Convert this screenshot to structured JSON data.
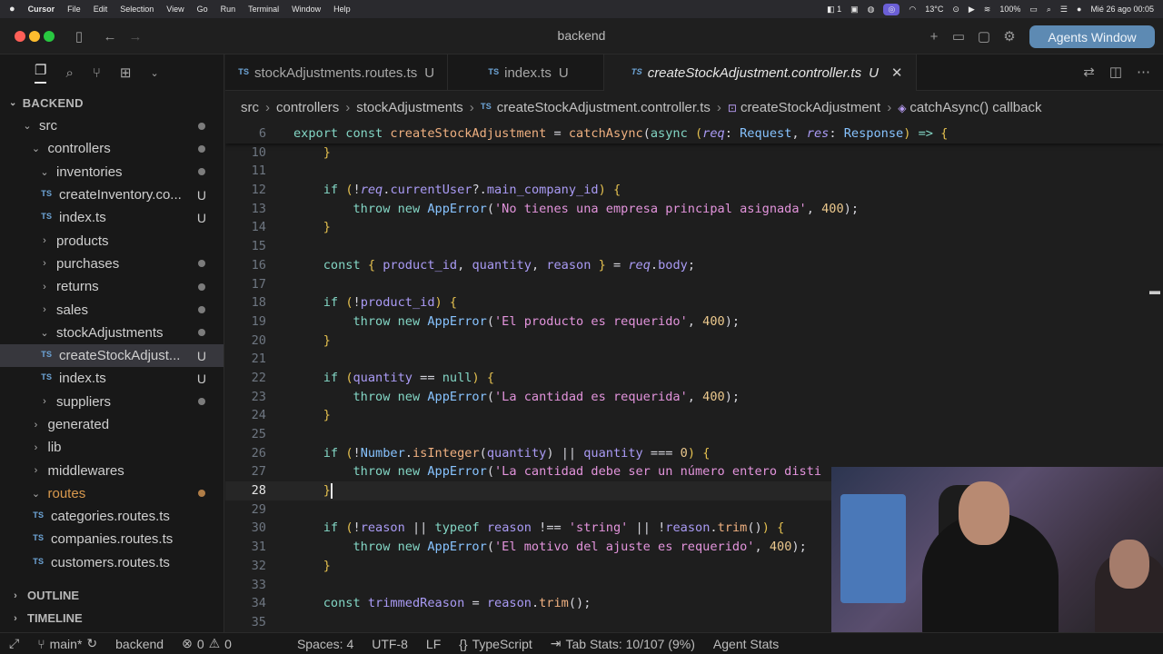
{
  "menubar": {
    "app": "Cursor",
    "items": [
      "File",
      "Edit",
      "Selection",
      "View",
      "Go",
      "Run",
      "Terminal",
      "Window",
      "Help"
    ],
    "status": {
      "badge": "1",
      "temp": "13°C",
      "battery": "100%",
      "datetime": "Mié 26 ago  00:05"
    }
  },
  "window": {
    "title": "backend",
    "agents_button": "Agents Window"
  },
  "sidebar": {
    "tabs": [
      "files-icon",
      "search-icon",
      "source-control-icon",
      "extensions-icon",
      "chevron-down-icon"
    ],
    "header": "BACKEND",
    "tree": [
      {
        "label": "src",
        "level": 0,
        "type": "folder-open",
        "dot": true
      },
      {
        "label": "controllers",
        "level": 1,
        "type": "folder-open",
        "dot": true
      },
      {
        "label": "inventories",
        "level": 2,
        "type": "folder-open",
        "dot": true
      },
      {
        "label": "createInventory.co...",
        "level": 3,
        "type": "file",
        "badge": "U"
      },
      {
        "label": "index.ts",
        "level": 3,
        "type": "file",
        "badge": "U"
      },
      {
        "label": "products",
        "level": 2,
        "type": "folder",
        "dot": false
      },
      {
        "label": "purchases",
        "level": 2,
        "type": "folder",
        "dot": true
      },
      {
        "label": "returns",
        "level": 2,
        "type": "folder",
        "dot": true
      },
      {
        "label": "sales",
        "level": 2,
        "type": "folder",
        "dot": true
      },
      {
        "label": "stockAdjustments",
        "level": 2,
        "type": "folder-open",
        "dot": true
      },
      {
        "label": "createStockAdjust...",
        "level": 3,
        "type": "file",
        "badge": "U",
        "selected": true
      },
      {
        "label": "index.ts",
        "level": 3,
        "type": "file",
        "badge": "U"
      },
      {
        "label": "suppliers",
        "level": 2,
        "type": "folder",
        "dot": true
      },
      {
        "label": "generated",
        "level": 1,
        "type": "folder",
        "dot": false
      },
      {
        "label": "lib",
        "level": 1,
        "type": "folder",
        "dot": false
      },
      {
        "label": "middlewares",
        "level": 1,
        "type": "folder",
        "dot": false
      },
      {
        "label": "routes",
        "level": 1,
        "type": "folder-open",
        "dot": true,
        "orange": true
      },
      {
        "label": "categories.routes.ts",
        "level": 2,
        "type": "file"
      },
      {
        "label": "companies.routes.ts",
        "level": 2,
        "type": "file"
      },
      {
        "label": "customers.routes.ts",
        "level": 2,
        "type": "file"
      }
    ],
    "outline": "OUTLINE",
    "timeline": "TIMELINE"
  },
  "tabs": [
    {
      "label": "stockAdjustments.routes.ts",
      "badge": "U",
      "active": false
    },
    {
      "label": "index.ts",
      "badge": "U",
      "active": false
    },
    {
      "label": "createStockAdjustment.controller.ts",
      "badge": "U",
      "active": true
    }
  ],
  "breadcrumb": [
    "src",
    "controllers",
    "stockAdjustments",
    "createStockAdjustment.controller.ts",
    "createStockAdjustment",
    "catchAsync() callback"
  ],
  "editor": {
    "sticky": {
      "ln": "6",
      "tokens": [
        [
          "k",
          "export "
        ],
        [
          "k",
          "const "
        ],
        [
          "f",
          "createStockAdjustment"
        ],
        [
          "v",
          " = "
        ],
        [
          "f",
          "catchAsync"
        ],
        [
          "v",
          "("
        ],
        [
          "k",
          "async "
        ],
        [
          "b",
          "("
        ],
        [
          "p i",
          "req"
        ],
        [
          "v",
          ": "
        ],
        [
          "t",
          "Request"
        ],
        [
          "v",
          ", "
        ],
        [
          "p i",
          "res"
        ],
        [
          "v",
          ": "
        ],
        [
          "t",
          "Response"
        ],
        [
          "b",
          ")"
        ],
        [
          "k",
          " => "
        ],
        [
          "b",
          "{"
        ]
      ]
    },
    "current_line": "28",
    "lines": [
      {
        "ln": "10",
        "tokens": [
          [
            "v",
            "    "
          ],
          [
            "b",
            "}"
          ]
        ]
      },
      {
        "ln": "11",
        "tokens": []
      },
      {
        "ln": "12",
        "tokens": [
          [
            "v",
            "    "
          ],
          [
            "k",
            "if "
          ],
          [
            "b",
            "("
          ],
          [
            "v",
            "!"
          ],
          [
            "p i",
            "req"
          ],
          [
            "v",
            "."
          ],
          [
            "p",
            "currentUser"
          ],
          [
            "v",
            "?."
          ],
          [
            "p",
            "main_company_id"
          ],
          [
            "b",
            ")"
          ],
          [
            "v",
            " "
          ],
          [
            "b",
            "{"
          ]
        ]
      },
      {
        "ln": "13",
        "tokens": [
          [
            "v",
            "        "
          ],
          [
            "k",
            "throw new "
          ],
          [
            "t",
            "AppError"
          ],
          [
            "v",
            "("
          ],
          [
            "s",
            "'No tienes una empresa principal asignada'"
          ],
          [
            "v",
            ", "
          ],
          [
            "n",
            "400"
          ],
          [
            "v",
            ");"
          ]
        ]
      },
      {
        "ln": "14",
        "tokens": [
          [
            "v",
            "    "
          ],
          [
            "b",
            "}"
          ]
        ]
      },
      {
        "ln": "15",
        "tokens": []
      },
      {
        "ln": "16",
        "tokens": [
          [
            "v",
            "    "
          ],
          [
            "k",
            "const "
          ],
          [
            "b",
            "{"
          ],
          [
            "v",
            " "
          ],
          [
            "p",
            "product_id"
          ],
          [
            "v",
            ", "
          ],
          [
            "p",
            "quantity"
          ],
          [
            "v",
            ", "
          ],
          [
            "p",
            "reason"
          ],
          [
            "v",
            " "
          ],
          [
            "b",
            "}"
          ],
          [
            "v",
            " = "
          ],
          [
            "p i",
            "req"
          ],
          [
            "v",
            "."
          ],
          [
            "p",
            "body"
          ],
          [
            "v",
            ";"
          ]
        ]
      },
      {
        "ln": "17",
        "tokens": []
      },
      {
        "ln": "18",
        "tokens": [
          [
            "v",
            "    "
          ],
          [
            "k",
            "if "
          ],
          [
            "b",
            "("
          ],
          [
            "v",
            "!"
          ],
          [
            "p",
            "product_id"
          ],
          [
            "b",
            ")"
          ],
          [
            "v",
            " "
          ],
          [
            "b",
            "{"
          ]
        ]
      },
      {
        "ln": "19",
        "tokens": [
          [
            "v",
            "        "
          ],
          [
            "k",
            "throw new "
          ],
          [
            "t",
            "AppError"
          ],
          [
            "v",
            "("
          ],
          [
            "s",
            "'El producto es requerido'"
          ],
          [
            "v",
            ", "
          ],
          [
            "n",
            "400"
          ],
          [
            "v",
            ");"
          ]
        ]
      },
      {
        "ln": "20",
        "tokens": [
          [
            "v",
            "    "
          ],
          [
            "b",
            "}"
          ]
        ]
      },
      {
        "ln": "21",
        "tokens": []
      },
      {
        "ln": "22",
        "tokens": [
          [
            "v",
            "    "
          ],
          [
            "k",
            "if "
          ],
          [
            "b",
            "("
          ],
          [
            "p",
            "quantity"
          ],
          [
            "v",
            " == "
          ],
          [
            "k",
            "null"
          ],
          [
            "b",
            ")"
          ],
          [
            "v",
            " "
          ],
          [
            "b",
            "{"
          ]
        ]
      },
      {
        "ln": "23",
        "tokens": [
          [
            "v",
            "        "
          ],
          [
            "k",
            "throw new "
          ],
          [
            "t",
            "AppError"
          ],
          [
            "v",
            "("
          ],
          [
            "s",
            "'La cantidad es requerida'"
          ],
          [
            "v",
            ", "
          ],
          [
            "n",
            "400"
          ],
          [
            "v",
            ");"
          ]
        ]
      },
      {
        "ln": "24",
        "tokens": [
          [
            "v",
            "    "
          ],
          [
            "b",
            "}"
          ]
        ]
      },
      {
        "ln": "25",
        "tokens": []
      },
      {
        "ln": "26",
        "tokens": [
          [
            "v",
            "    "
          ],
          [
            "k",
            "if "
          ],
          [
            "b",
            "("
          ],
          [
            "v",
            "!"
          ],
          [
            "t",
            "Number"
          ],
          [
            "v",
            "."
          ],
          [
            "f",
            "isInteger"
          ],
          [
            "v",
            "("
          ],
          [
            "p",
            "quantity"
          ],
          [
            "v",
            ") || "
          ],
          [
            "p",
            "quantity"
          ],
          [
            "v",
            " === "
          ],
          [
            "n",
            "0"
          ],
          [
            "b",
            ")"
          ],
          [
            "v",
            " "
          ],
          [
            "b",
            "{"
          ]
        ]
      },
      {
        "ln": "27",
        "tokens": [
          [
            "v",
            "        "
          ],
          [
            "k",
            "throw new "
          ],
          [
            "t",
            "AppError"
          ],
          [
            "v",
            "("
          ],
          [
            "s",
            "'La cantidad debe ser un número entero disti"
          ]
        ]
      },
      {
        "ln": "28",
        "tokens": [
          [
            "v",
            "    "
          ],
          [
            "b",
            "}"
          ]
        ],
        "cursor": true
      },
      {
        "ln": "29",
        "tokens": []
      },
      {
        "ln": "30",
        "tokens": [
          [
            "v",
            "    "
          ],
          [
            "k",
            "if "
          ],
          [
            "b",
            "("
          ],
          [
            "v",
            "!"
          ],
          [
            "p",
            "reason"
          ],
          [
            "v",
            " || "
          ],
          [
            "k",
            "typeof "
          ],
          [
            "p",
            "reason"
          ],
          [
            "v",
            " !== "
          ],
          [
            "s",
            "'string'"
          ],
          [
            "v",
            " || !"
          ],
          [
            "p",
            "reason"
          ],
          [
            "v",
            "."
          ],
          [
            "f",
            "trim"
          ],
          [
            "v",
            "()"
          ],
          [
            "b",
            ")"
          ],
          [
            "v",
            " "
          ],
          [
            "b",
            "{"
          ]
        ]
      },
      {
        "ln": "31",
        "tokens": [
          [
            "v",
            "        "
          ],
          [
            "k",
            "throw new "
          ],
          [
            "t",
            "AppError"
          ],
          [
            "v",
            "("
          ],
          [
            "s",
            "'El motivo del ajuste es requerido'"
          ],
          [
            "v",
            ", "
          ],
          [
            "n",
            "400"
          ],
          [
            "v",
            ");"
          ]
        ]
      },
      {
        "ln": "32",
        "tokens": [
          [
            "v",
            "    "
          ],
          [
            "b",
            "}"
          ]
        ]
      },
      {
        "ln": "33",
        "tokens": []
      },
      {
        "ln": "34",
        "tokens": [
          [
            "v",
            "    "
          ],
          [
            "k",
            "const "
          ],
          [
            "p",
            "trimmedReason"
          ],
          [
            "v",
            " = "
          ],
          [
            "p",
            "reason"
          ],
          [
            "v",
            "."
          ],
          [
            "f",
            "trim"
          ],
          [
            "v",
            "();"
          ]
        ]
      },
      {
        "ln": "35",
        "tokens": []
      }
    ]
  },
  "statusbar": {
    "branch": "main*",
    "folder": "backend",
    "errors": "0",
    "warnings": "0",
    "spaces": "Spaces: 4",
    "encoding": "UTF-8",
    "eol": "LF",
    "language": "TypeScript",
    "tabstats": "Tab Stats: 10/107 (9%)",
    "agent": "Agent Stats"
  },
  "colors": {
    "accent": "#5d8ab3",
    "keyword": "#83d6c5",
    "string": "#e394dc",
    "function": "#efb080",
    "modified_folder": "#d99a4e"
  }
}
